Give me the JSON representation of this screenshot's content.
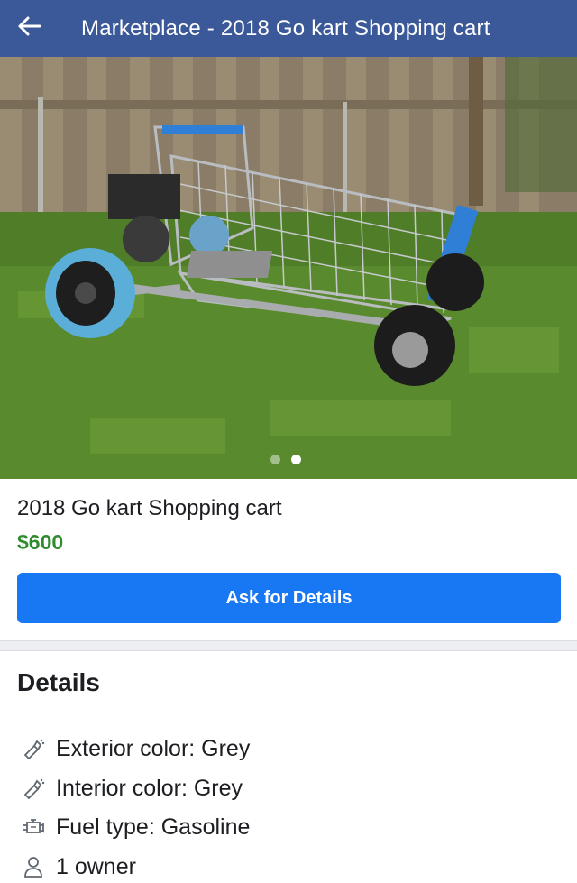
{
  "header": {
    "title": "Marketplace - 2018 Go kart Shopping cart",
    "back_icon": "arrow-left-icon",
    "background": "#3b5998"
  },
  "photo": {
    "alt": "",
    "pager": {
      "total": 2,
      "active": 2
    }
  },
  "listing": {
    "title": "2018 Go kart Shopping cart",
    "price": "$600",
    "price_color": "#2e8b2e"
  },
  "actions": {
    "ask_label": "Ask for Details",
    "ask_color": "#1877f2"
  },
  "details": {
    "heading": "Details",
    "items": [
      {
        "icon": "paint-spray-icon",
        "text": "Exterior color: Grey"
      },
      {
        "icon": "paint-spray-icon",
        "text": "Interior color: Grey"
      },
      {
        "icon": "engine-icon",
        "text": "Fuel type: Gasoline"
      },
      {
        "icon": "person-icon",
        "text": "1 owner"
      }
    ]
  }
}
